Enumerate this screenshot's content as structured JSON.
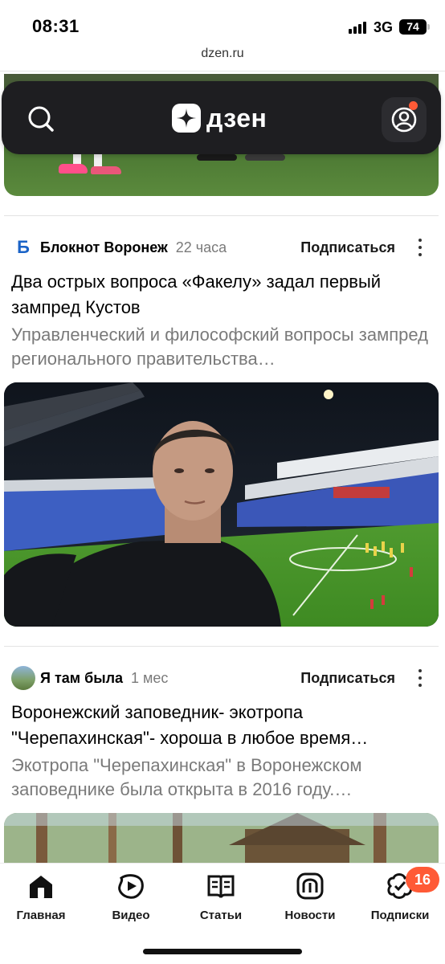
{
  "status_bar": {
    "time": "08:31",
    "network": "3G",
    "battery": "74"
  },
  "browser": {
    "url": "dzen.ru"
  },
  "header": {
    "logo_text": "дзен",
    "search_icon": "search-icon",
    "profile_icon": "profile-icon",
    "notification_color": "#ff5a36",
    "background": "#1e1e21"
  },
  "posts": [
    {
      "source_initial": "Б",
      "source_name": "Блокнот Воронеж",
      "time": "22 часа",
      "subscribe_label": "Подписаться",
      "title": "Два острых вопроса «Факелу» задал первый зампред Кустов",
      "description": "Управленческий и философский вопросы зампред регионального правительства…"
    },
    {
      "source_name": "Я там была",
      "time": "1 мес",
      "subscribe_label": "Подписаться",
      "title": "Воронежский заповедник- экотропа \"Черепахинская\"- хороша в любое время…",
      "description": "Экотропа \"Черепахинская\" в Воронежском заповеднике была открыта в 2016 году.…"
    }
  ],
  "bottom_nav": {
    "items": [
      {
        "label": "Главная",
        "icon": "home-icon"
      },
      {
        "label": "Видео",
        "icon": "video-icon"
      },
      {
        "label": "Статьи",
        "icon": "book-icon"
      },
      {
        "label": "Новости",
        "icon": "news-icon"
      },
      {
        "label": "Подписки",
        "icon": "subscriptions-icon"
      }
    ],
    "subscriptions_badge": "16",
    "accent": "#ff5a36"
  }
}
